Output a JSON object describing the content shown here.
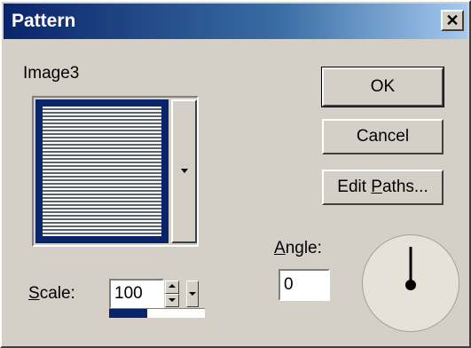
{
  "window": {
    "title": "Pattern",
    "close_symbol": "✕"
  },
  "pattern": {
    "name": "Image3",
    "dropdown_icon": "dropdown-caret"
  },
  "buttons": {
    "ok_label": "OK",
    "cancel_label": "Cancel",
    "edit_paths_prefix": "Edit ",
    "edit_paths_mnemonic": "P",
    "edit_paths_suffix": "aths..."
  },
  "scale": {
    "label_mnemonic": "S",
    "label_rest": "cale:",
    "value": "100",
    "level_fraction": 0.4
  },
  "angle": {
    "label_mnemonic": "A",
    "label_rest": "ngle:",
    "value": "0",
    "degrees": 0
  },
  "colors": {
    "face": "#d4d0c8",
    "title_active": "#0a246a",
    "title_gradient_end": "#a6caf0"
  }
}
